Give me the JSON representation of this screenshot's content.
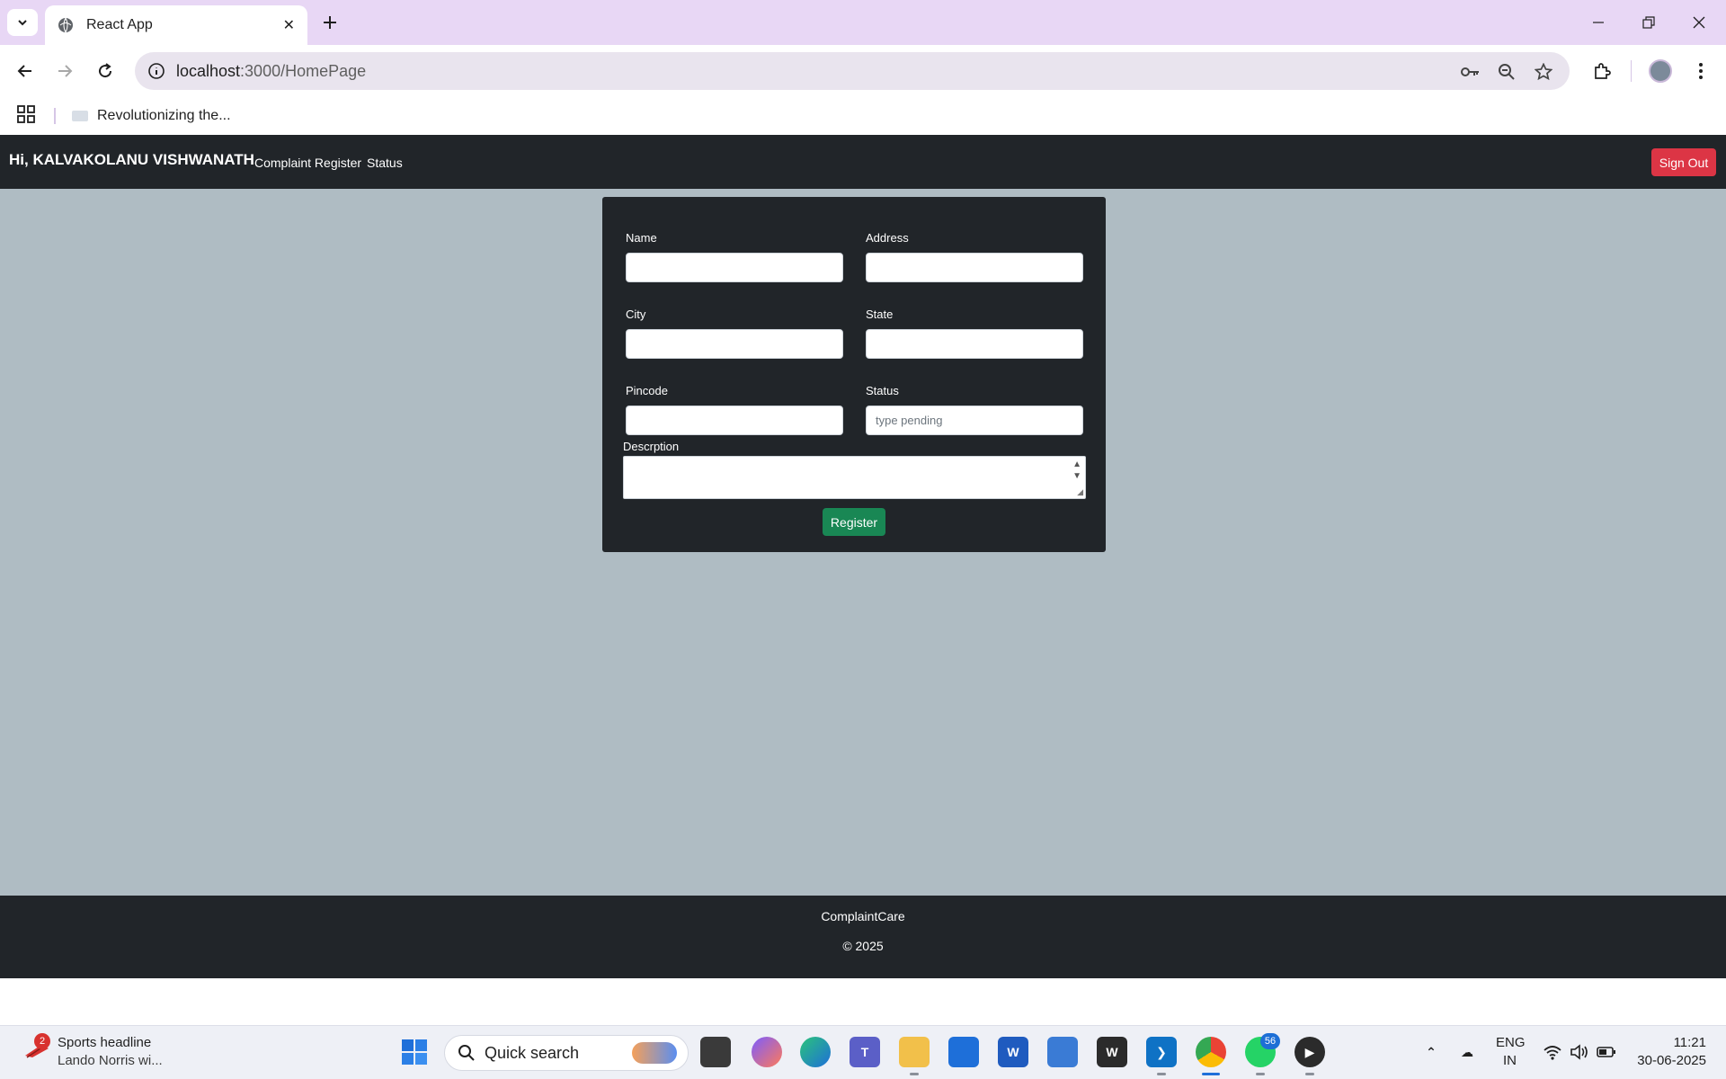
{
  "browser": {
    "tab_title": "React App",
    "url_host": "localhost",
    "url_path": ":3000/HomePage",
    "bookmark_label": "Revolutionizing the..."
  },
  "app": {
    "greeting": "Hi, KALVAKOLANU VISHWANATH",
    "nav": {
      "complaint_register": "Complaint Register",
      "status": "Status"
    },
    "sign_out_label": "Sign Out"
  },
  "form": {
    "name_label": "Name",
    "address_label": "Address",
    "city_label": "City",
    "state_label": "State",
    "pincode_label": "Pincode",
    "status_label": "Status",
    "status_placeholder": "type pending",
    "description_label": "Descrption",
    "name_value": "",
    "address_value": "",
    "city_value": "",
    "state_value": "",
    "pincode_value": "",
    "register_label": "Register"
  },
  "footer": {
    "brand": "ComplaintCare",
    "copyright": "© 2025"
  },
  "taskbar": {
    "news_badge": "2",
    "news_title": "Sports headline",
    "news_sub": "Lando Norris wi...",
    "search_placeholder": "Quick search",
    "whatsapp_badge": "56",
    "lang_top": "ENG",
    "lang_bottom": "IN",
    "time": "11:21",
    "date": "30-06-2025"
  },
  "colors": {
    "navbar": "#212529",
    "page_bg": "#afbcc3",
    "sign_out": "#dc3545",
    "register": "#198754",
    "tabstrip": "#e8d7f5"
  }
}
